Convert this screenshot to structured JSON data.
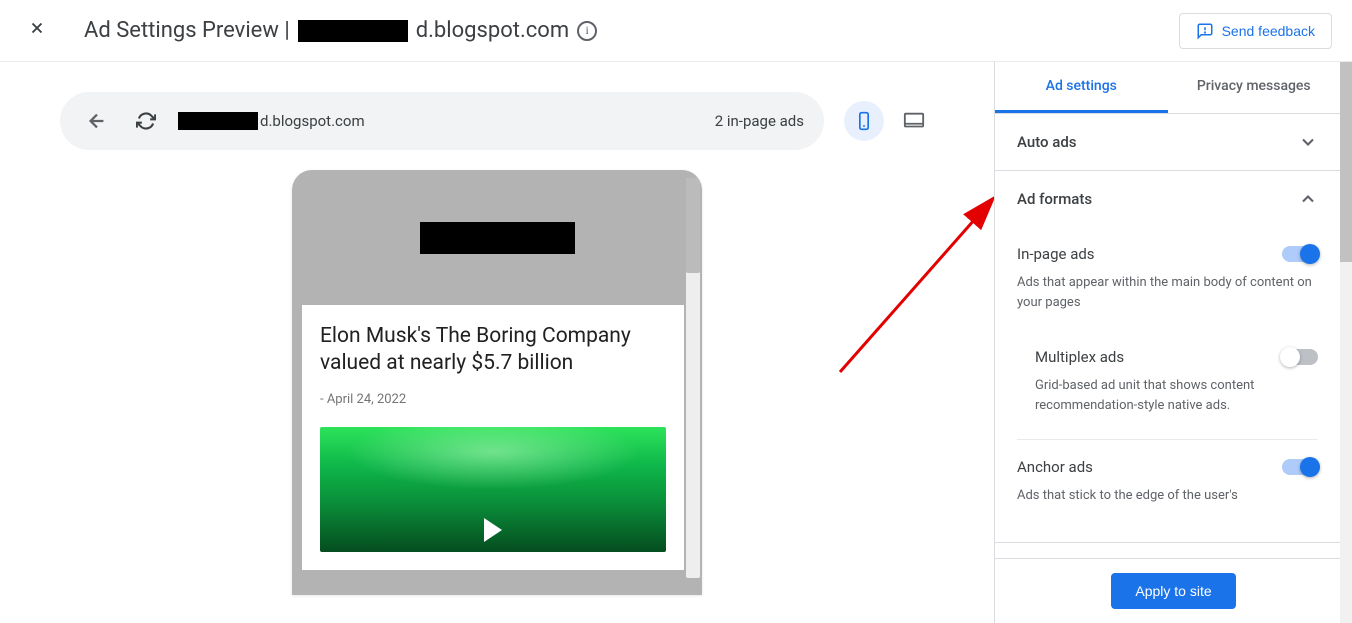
{
  "header": {
    "title_prefix": "Ad Settings Preview | ",
    "title_suffix": "d.blogspot.com",
    "feedback_label": "Send feedback"
  },
  "urlbar": {
    "url_suffix": "d.blogspot.com",
    "ad_count": "2 in-page ads"
  },
  "preview": {
    "article_title": "Elon Musk's The Boring Company valued at nearly $5.7 billion",
    "article_date": "- April 24, 2022"
  },
  "sidebar": {
    "tabs": {
      "settings": "Ad settings",
      "privacy": "Privacy messages"
    },
    "auto_ads_title": "Auto ads",
    "ad_formats_title": "Ad formats",
    "formats": {
      "inpage": {
        "name": "In-page ads",
        "desc": "Ads that appear within the main body of content on your pages"
      },
      "multiplex": {
        "name": "Multiplex ads",
        "desc": "Grid-based ad unit that shows content recommendation-style native ads."
      },
      "anchor": {
        "name": "Anchor ads",
        "desc": "Ads that stick to the edge of the user's"
      }
    },
    "apply_label": "Apply to site"
  }
}
